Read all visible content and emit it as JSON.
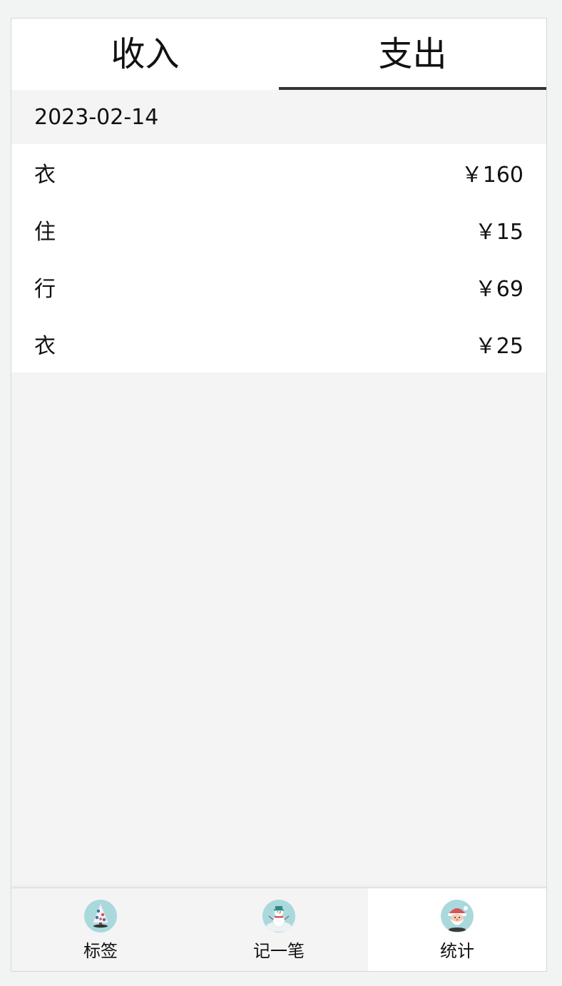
{
  "tabs": [
    {
      "label": "收入",
      "active": false
    },
    {
      "label": "支出",
      "active": true
    }
  ],
  "group": {
    "date": "2023-02-14",
    "records": [
      {
        "category": "衣",
        "amount": "￥160"
      },
      {
        "category": "住",
        "amount": "￥15"
      },
      {
        "category": "行",
        "amount": "￥69"
      },
      {
        "category": "衣",
        "amount": "￥25"
      }
    ]
  },
  "nav": {
    "items": [
      {
        "label": "标签",
        "icon": "christmas-tree-icon"
      },
      {
        "label": "记一笔",
        "icon": "snowman-icon"
      },
      {
        "label": "统计",
        "icon": "santa-icon"
      }
    ],
    "selected": "统计"
  },
  "colors": {
    "accent": "#333333",
    "page_bg": "#f4f4f4",
    "card_bg": "#ffffff",
    "icon_bg": "#a9d9dc"
  }
}
